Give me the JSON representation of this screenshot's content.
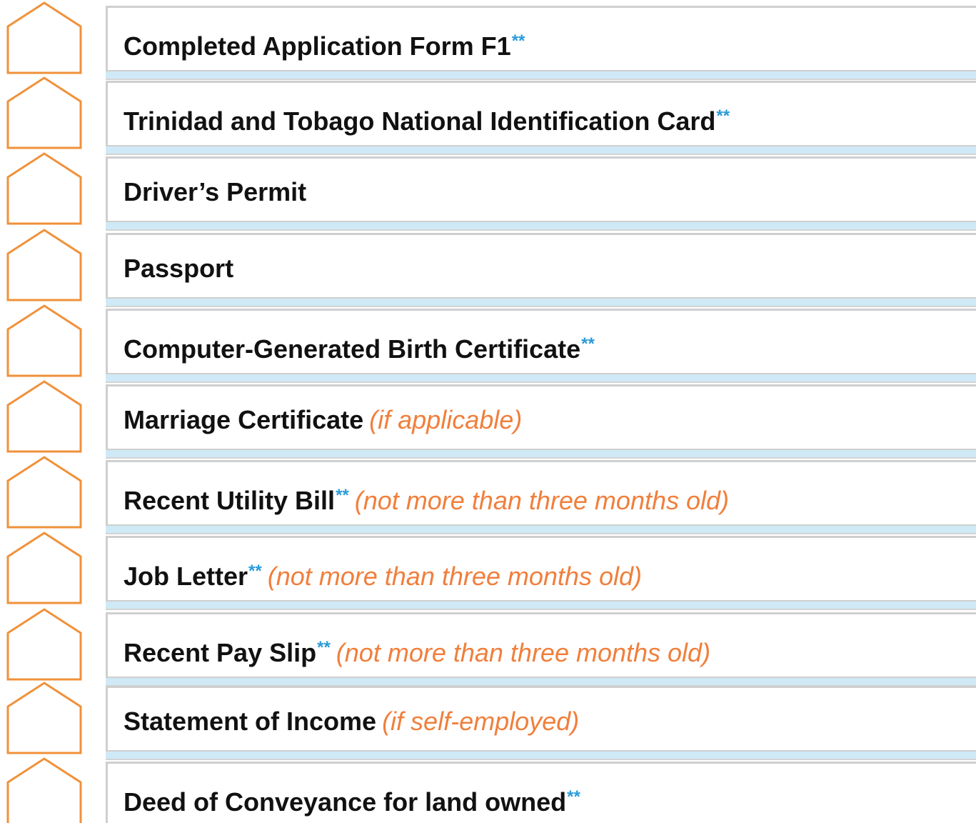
{
  "checklist": {
    "colors": {
      "checkbox_outline": "#f0913a",
      "required_marker": "#2a9bd8",
      "note_text": "#f07f3c",
      "separator_band": "#cfe9f6",
      "card_border": "#cfcfcf"
    },
    "icon": "house-checkbox-icon",
    "items": [
      {
        "label": "Completed Application Form F1",
        "marker": "**",
        "note": ""
      },
      {
        "label": "Trinidad and Tobago National Identification Card",
        "marker": "**",
        "note": ""
      },
      {
        "label": "Driver’s Permit",
        "marker": "",
        "note": ""
      },
      {
        "label": "Passport",
        "marker": "",
        "note": ""
      },
      {
        "label": "Computer-Generated Birth Certificate",
        "marker": "**",
        "note": ""
      },
      {
        "label": "Marriage Certificate",
        "marker": "",
        "note": "(if applicable)"
      },
      {
        "label": "Recent Utility Bill",
        "marker": "**",
        "note": "(not more than three months old)"
      },
      {
        "label": "Job Letter",
        "marker": "**",
        "note": "(not more than three months old)"
      },
      {
        "label": "Recent Pay Slip",
        "marker": "**",
        "note": "(not more than three months old)"
      },
      {
        "label": "Statement of Income",
        "marker": "",
        "note": "(if self-employed)"
      },
      {
        "label": "Deed of Conveyance for land owned",
        "marker": "**",
        "note": ""
      }
    ]
  }
}
